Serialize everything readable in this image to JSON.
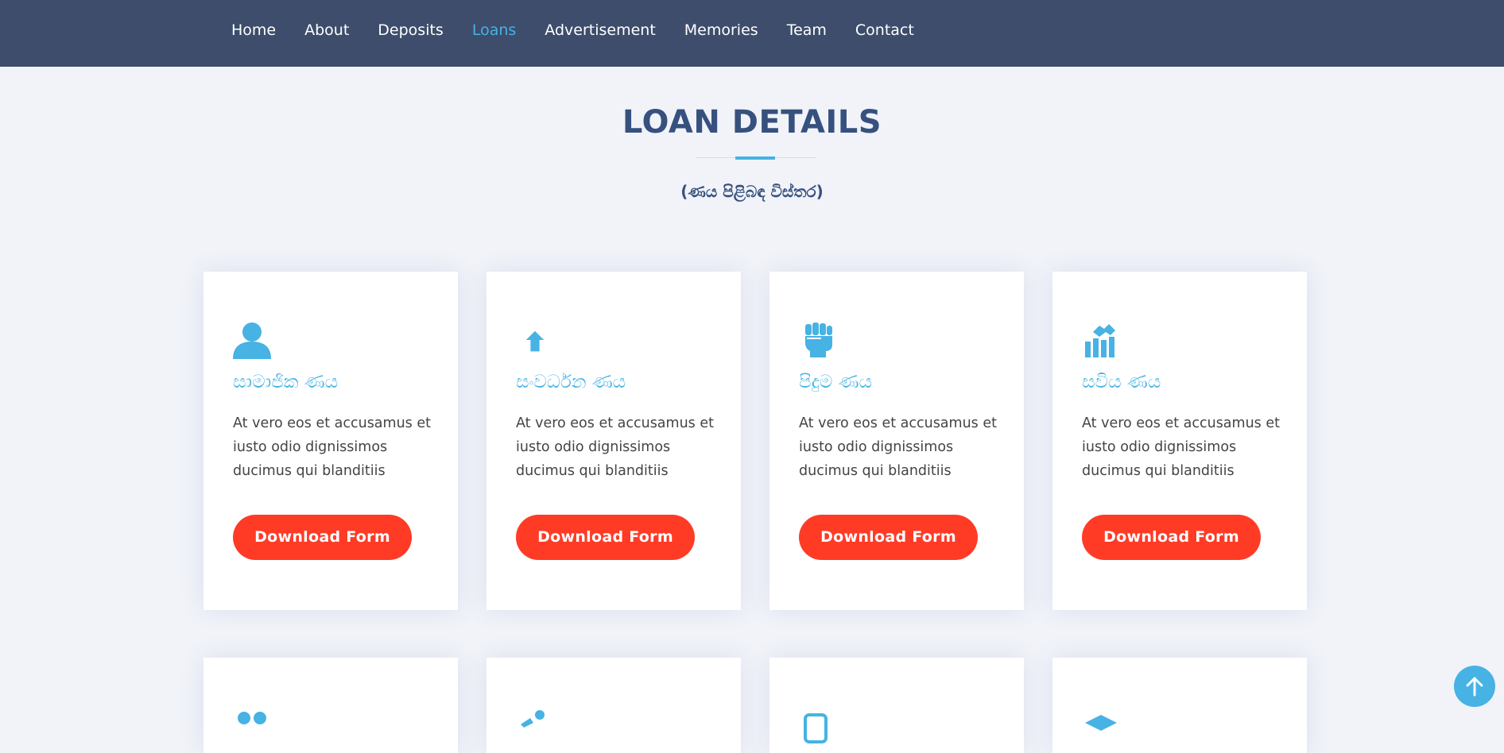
{
  "nav": {
    "items": [
      {
        "label": "Home",
        "active": false
      },
      {
        "label": "About",
        "active": false
      },
      {
        "label": "Deposits",
        "active": false
      },
      {
        "label": "Loans",
        "active": true
      },
      {
        "label": "Advertisement",
        "active": false
      },
      {
        "label": "Memories",
        "active": false
      },
      {
        "label": "Team",
        "active": false
      },
      {
        "label": "Contact",
        "active": false
      }
    ]
  },
  "section": {
    "title": "LOAN DETAILS",
    "subtitle": "(ණය පිළිබඳ විස්තර)"
  },
  "cards": [
    {
      "icon": "person-icon",
      "title": "සාමාජික ණය",
      "text": "At vero eos et accusamus et iusto odio dignissimos ducimus qui blanditiis",
      "button": "Download Form"
    },
    {
      "icon": "arrow-up-icon",
      "title": "සංවර්ධන ණය",
      "text": "At vero eos et accusamus et iusto odio dignissimos ducimus qui blanditiis",
      "button": "Download Form"
    },
    {
      "icon": "raised-fist-icon",
      "title": "පිදුම ණය",
      "text": "At vero eos et accusamus et iusto odio dignissimos ducimus qui blanditiis",
      "button": "Download Form"
    },
    {
      "icon": "handshake-chart-icon",
      "title": "සවිය ණය",
      "text": "At vero eos et accusamus et iusto odio dignissimos ducimus qui blanditiis",
      "button": "Download Form"
    }
  ],
  "row2_icons": [
    "people-icon",
    "person-walk-icon",
    "device-icon",
    "graduation-cap-icon"
  ],
  "colors": {
    "nav_bg": "#3d4d6b",
    "accent": "#47b2e4",
    "heading": "#37517e",
    "button": "#ff3b26",
    "page_bg": "#f1f3f9"
  }
}
